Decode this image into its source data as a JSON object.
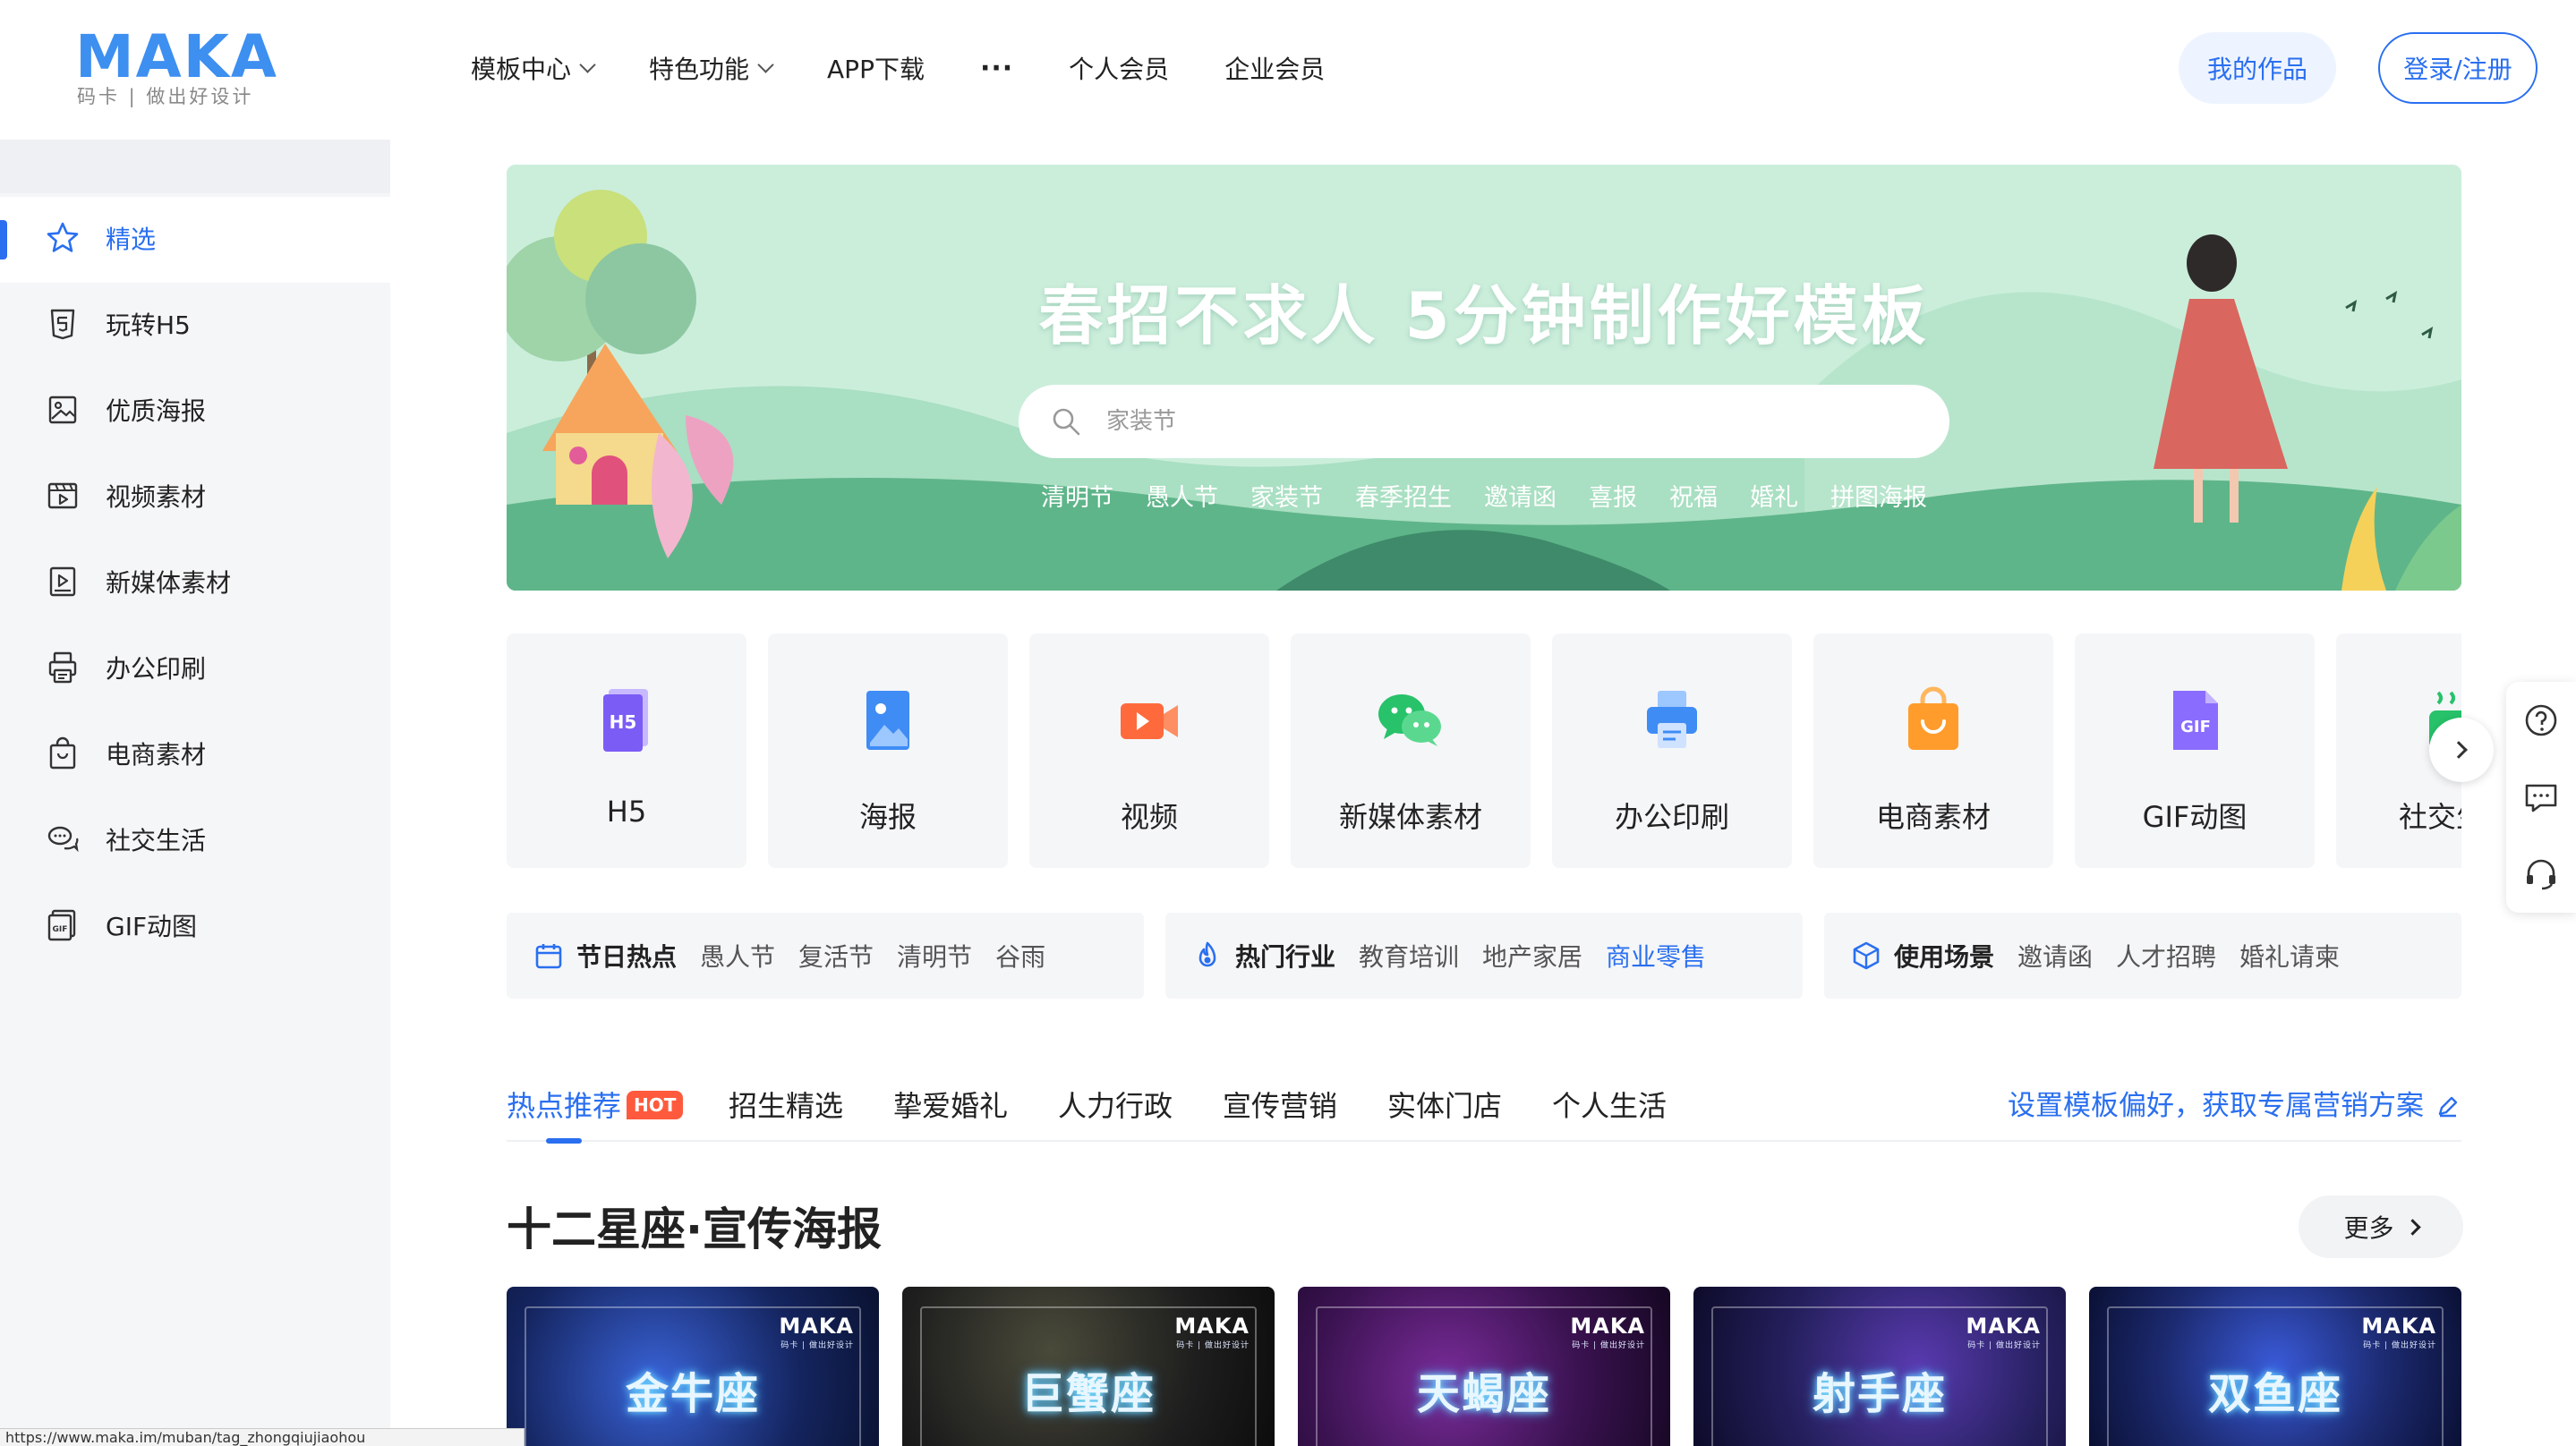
{
  "brand": {
    "logo": "MAKA",
    "tagline": "码卡 | 做出好设计"
  },
  "nav": {
    "items": [
      "模板中心",
      "特色功能",
      "APP下载",
      "···",
      "个人会员",
      "企业会员"
    ],
    "my_works": "我的作品",
    "login": "登录/注册"
  },
  "sidebar": {
    "items": [
      {
        "label": "精选",
        "icon": "star-icon",
        "active": true
      },
      {
        "label": "玩转H5",
        "icon": "h5-icon"
      },
      {
        "label": "优质海报",
        "icon": "image-icon"
      },
      {
        "label": "视频素材",
        "icon": "video-icon"
      },
      {
        "label": "新媒体素材",
        "icon": "play-doc-icon"
      },
      {
        "label": "办公印刷",
        "icon": "printer-icon"
      },
      {
        "label": "电商素材",
        "icon": "shopping-bag-icon"
      },
      {
        "label": "社交生活",
        "icon": "chat-icon"
      },
      {
        "label": "GIF动图",
        "icon": "gif-icon"
      }
    ]
  },
  "banner": {
    "title": "春招不求人 5分钟制作好模板",
    "search_placeholder": "家装节",
    "hot_words": [
      "清明节",
      "愚人节",
      "家装节",
      "春季招生",
      "邀请函",
      "喜报",
      "祝福",
      "婚礼",
      "拼图海报"
    ]
  },
  "categories": [
    {
      "label": "H5",
      "icon": "h5-category-icon",
      "color": "#7b5cf5"
    },
    {
      "label": "海报",
      "icon": "poster-category-icon",
      "color": "#3f8cf5"
    },
    {
      "label": "视频",
      "icon": "video-category-icon",
      "color": "#ff6a3d"
    },
    {
      "label": "新媒体素材",
      "icon": "wechat-category-icon",
      "color": "#27c26a"
    },
    {
      "label": "办公印刷",
      "icon": "printer-category-icon",
      "color": "#3f8cf5"
    },
    {
      "label": "电商素材",
      "icon": "bag-category-icon",
      "color": "#ff9c2b"
    },
    {
      "label": "GIF动图",
      "icon": "gif-category-icon",
      "color": "#8a6cff"
    },
    {
      "label": "社交生活",
      "icon": "social-category-icon",
      "color": "#27c26a"
    }
  ],
  "panels": [
    {
      "title": "节日热点",
      "icon": "calendar-icon",
      "tags": [
        "愚人节",
        "复活节",
        "清明节",
        "谷雨"
      ],
      "highlight": null
    },
    {
      "title": "热门行业",
      "icon": "flame-icon",
      "tags": [
        "教育培训",
        "地产家居",
        "商业零售"
      ],
      "highlight": 2
    },
    {
      "title": "使用场景",
      "icon": "cube-icon",
      "tags": [
        "邀请函",
        "人才招聘",
        "婚礼请柬"
      ],
      "highlight": null
    }
  ],
  "tabs": {
    "items": [
      "热点推荐",
      "招生精选",
      "挚爱婚礼",
      "人力行政",
      "宣传营销",
      "实体门店",
      "个人生活"
    ],
    "hot_badge": "HOT",
    "preference_link": "设置模板偏好，获取专属营销方案"
  },
  "section": {
    "title": "十二星座·宣传海报",
    "more": "更多",
    "cards": [
      {
        "title": "金牛座",
        "brand": "MAKA",
        "brand_sub": "码卡 | 做出好设计",
        "bg": "#1a2a66"
      },
      {
        "title": "巨蟹座",
        "brand": "MAKA",
        "brand_sub": "码卡 | 做出好设计",
        "bg": "#222222"
      },
      {
        "title": "天蝎座",
        "brand": "MAKA",
        "brand_sub": "码卡 | 做出好设计",
        "bg": "#3a1250"
      },
      {
        "title": "射手座",
        "brand": "MAKA",
        "brand_sub": "码卡 | 做出好设计",
        "bg": "#25205e"
      },
      {
        "title": "双鱼座",
        "brand": "MAKA",
        "brand_sub": "码卡 | 做出好设计",
        "bg": "#1c2a70"
      }
    ]
  },
  "status_bar": {
    "url": "https://www.maka.im/muban/tag_zhongqiujiaohou"
  },
  "colors": {
    "accent": "#2a6ff0",
    "banner_bg": "#c8ead6",
    "hot": "#ff5a3d"
  }
}
